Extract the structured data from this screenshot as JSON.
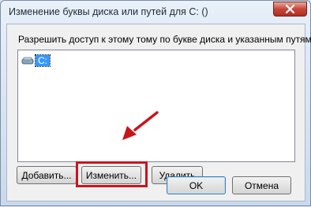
{
  "window": {
    "title": "Изменение буквы диска или путей для C: ()"
  },
  "description": "Разрешить доступ к этому тому по букве диска и указанным путям.",
  "list": {
    "items": [
      {
        "label": "C:",
        "selected": true,
        "icon": "drive-icon"
      }
    ]
  },
  "buttons": {
    "add": {
      "label": "Добавить..."
    },
    "change": {
      "label": "Изменить..."
    },
    "delete": {
      "label": "Удалить"
    },
    "ok": {
      "label": "OK"
    },
    "cancel": {
      "label": "Отмена"
    }
  },
  "icons": {
    "close": "close-icon",
    "drive": "drive-icon",
    "arrow": "red-arrow-annotation"
  },
  "colors": {
    "selection": "#3399ff",
    "annotation": "#c8161d",
    "close_button": "#c7463a"
  }
}
